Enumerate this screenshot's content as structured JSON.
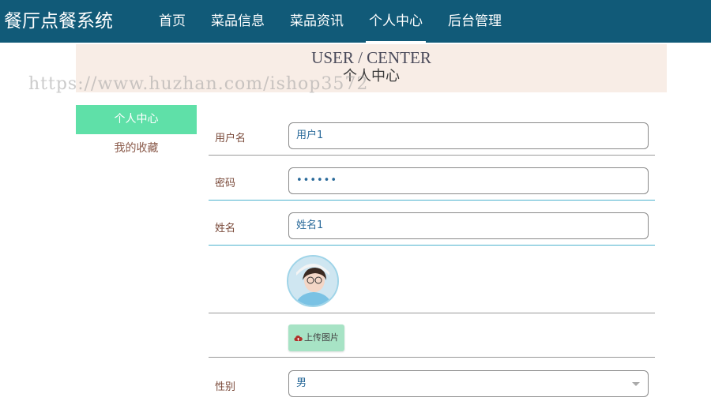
{
  "header": {
    "brand": "餐厅点餐系统",
    "nav": [
      "首页",
      "菜品信息",
      "菜品资讯",
      "个人中心",
      "后台管理"
    ],
    "active_nav": "个人中心"
  },
  "banner": {
    "title_en": "USER / CENTER",
    "title_cn": "个人中心"
  },
  "watermark": "https://www.huzhan.com/ishop3572",
  "sidebar": {
    "items": [
      "个人中心",
      "我的收藏"
    ],
    "active": "个人中心"
  },
  "form": {
    "username_label": "用户名",
    "username_value": "用户1",
    "password_label": "密码",
    "password_value": "••••••",
    "name_label": "姓名",
    "name_value": "姓名1",
    "upload_label": "上传图片",
    "gender_label": "性别",
    "gender_value": "男"
  },
  "colors": {
    "topbar": "#115a78",
    "banner": "#f8ede6",
    "sidebar_active": "#5fe0a8",
    "upload": "#a7e3c5"
  },
  "icons": {
    "upload": "cloud-upload-icon",
    "select": "chevron-down-icon"
  }
}
